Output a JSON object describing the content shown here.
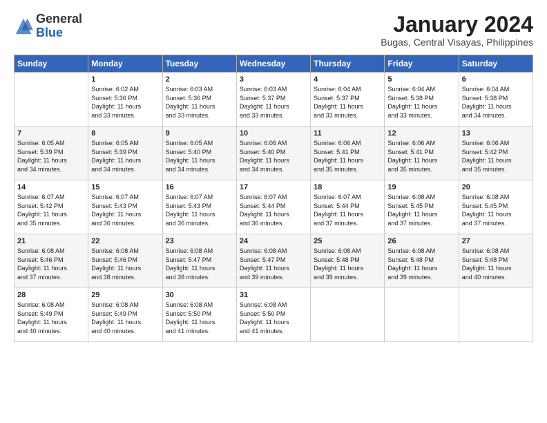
{
  "logo": {
    "general": "General",
    "blue": "Blue"
  },
  "title": "January 2024",
  "subtitle": "Bugas, Central Visayas, Philippines",
  "days_of_week": [
    "Sunday",
    "Monday",
    "Tuesday",
    "Wednesday",
    "Thursday",
    "Friday",
    "Saturday"
  ],
  "weeks": [
    [
      {
        "day": "",
        "info": ""
      },
      {
        "day": "1",
        "info": "Sunrise: 6:02 AM\nSunset: 5:36 PM\nDaylight: 11 hours\nand 33 minutes."
      },
      {
        "day": "2",
        "info": "Sunrise: 6:03 AM\nSunset: 5:36 PM\nDaylight: 11 hours\nand 33 minutes."
      },
      {
        "day": "3",
        "info": "Sunrise: 6:03 AM\nSunset: 5:37 PM\nDaylight: 11 hours\nand 33 minutes."
      },
      {
        "day": "4",
        "info": "Sunrise: 6:04 AM\nSunset: 5:37 PM\nDaylight: 11 hours\nand 33 minutes."
      },
      {
        "day": "5",
        "info": "Sunrise: 6:04 AM\nSunset: 5:38 PM\nDaylight: 11 hours\nand 33 minutes."
      },
      {
        "day": "6",
        "info": "Sunrise: 6:04 AM\nSunset: 5:38 PM\nDaylight: 11 hours\nand 34 minutes."
      }
    ],
    [
      {
        "day": "7",
        "info": "Sunrise: 6:05 AM\nSunset: 5:39 PM\nDaylight: 11 hours\nand 34 minutes."
      },
      {
        "day": "8",
        "info": "Sunrise: 6:05 AM\nSunset: 5:39 PM\nDaylight: 11 hours\nand 34 minutes."
      },
      {
        "day": "9",
        "info": "Sunrise: 6:05 AM\nSunset: 5:40 PM\nDaylight: 11 hours\nand 34 minutes."
      },
      {
        "day": "10",
        "info": "Sunrise: 6:06 AM\nSunset: 5:40 PM\nDaylight: 11 hours\nand 34 minutes."
      },
      {
        "day": "11",
        "info": "Sunrise: 6:06 AM\nSunset: 5:41 PM\nDaylight: 11 hours\nand 35 minutes."
      },
      {
        "day": "12",
        "info": "Sunrise: 6:06 AM\nSunset: 5:41 PM\nDaylight: 11 hours\nand 35 minutes."
      },
      {
        "day": "13",
        "info": "Sunrise: 6:06 AM\nSunset: 5:42 PM\nDaylight: 11 hours\nand 35 minutes."
      }
    ],
    [
      {
        "day": "14",
        "info": "Sunrise: 6:07 AM\nSunset: 5:42 PM\nDaylight: 11 hours\nand 35 minutes."
      },
      {
        "day": "15",
        "info": "Sunrise: 6:07 AM\nSunset: 5:43 PM\nDaylight: 11 hours\nand 36 minutes."
      },
      {
        "day": "16",
        "info": "Sunrise: 6:07 AM\nSunset: 5:43 PM\nDaylight: 11 hours\nand 36 minutes."
      },
      {
        "day": "17",
        "info": "Sunrise: 6:07 AM\nSunset: 5:44 PM\nDaylight: 11 hours\nand 36 minutes."
      },
      {
        "day": "18",
        "info": "Sunrise: 6:07 AM\nSunset: 5:44 PM\nDaylight: 11 hours\nand 37 minutes."
      },
      {
        "day": "19",
        "info": "Sunrise: 6:08 AM\nSunset: 5:45 PM\nDaylight: 11 hours\nand 37 minutes."
      },
      {
        "day": "20",
        "info": "Sunrise: 6:08 AM\nSunset: 5:45 PM\nDaylight: 11 hours\nand 37 minutes."
      }
    ],
    [
      {
        "day": "21",
        "info": "Sunrise: 6:08 AM\nSunset: 5:46 PM\nDaylight: 11 hours\nand 37 minutes."
      },
      {
        "day": "22",
        "info": "Sunrise: 6:08 AM\nSunset: 5:46 PM\nDaylight: 11 hours\nand 38 minutes."
      },
      {
        "day": "23",
        "info": "Sunrise: 6:08 AM\nSunset: 5:47 PM\nDaylight: 11 hours\nand 38 minutes."
      },
      {
        "day": "24",
        "info": "Sunrise: 6:08 AM\nSunset: 5:47 PM\nDaylight: 11 hours\nand 39 minutes."
      },
      {
        "day": "25",
        "info": "Sunrise: 6:08 AM\nSunset: 5:48 PM\nDaylight: 11 hours\nand 39 minutes."
      },
      {
        "day": "26",
        "info": "Sunrise: 6:08 AM\nSunset: 5:48 PM\nDaylight: 11 hours\nand 39 minutes."
      },
      {
        "day": "27",
        "info": "Sunrise: 6:08 AM\nSunset: 5:48 PM\nDaylight: 11 hours\nand 40 minutes."
      }
    ],
    [
      {
        "day": "28",
        "info": "Sunrise: 6:08 AM\nSunset: 5:49 PM\nDaylight: 11 hours\nand 40 minutes."
      },
      {
        "day": "29",
        "info": "Sunrise: 6:08 AM\nSunset: 5:49 PM\nDaylight: 11 hours\nand 40 minutes."
      },
      {
        "day": "30",
        "info": "Sunrise: 6:08 AM\nSunset: 5:50 PM\nDaylight: 11 hours\nand 41 minutes."
      },
      {
        "day": "31",
        "info": "Sunrise: 6:08 AM\nSunset: 5:50 PM\nDaylight: 11 hours\nand 41 minutes."
      },
      {
        "day": "",
        "info": ""
      },
      {
        "day": "",
        "info": ""
      },
      {
        "day": "",
        "info": ""
      }
    ]
  ]
}
